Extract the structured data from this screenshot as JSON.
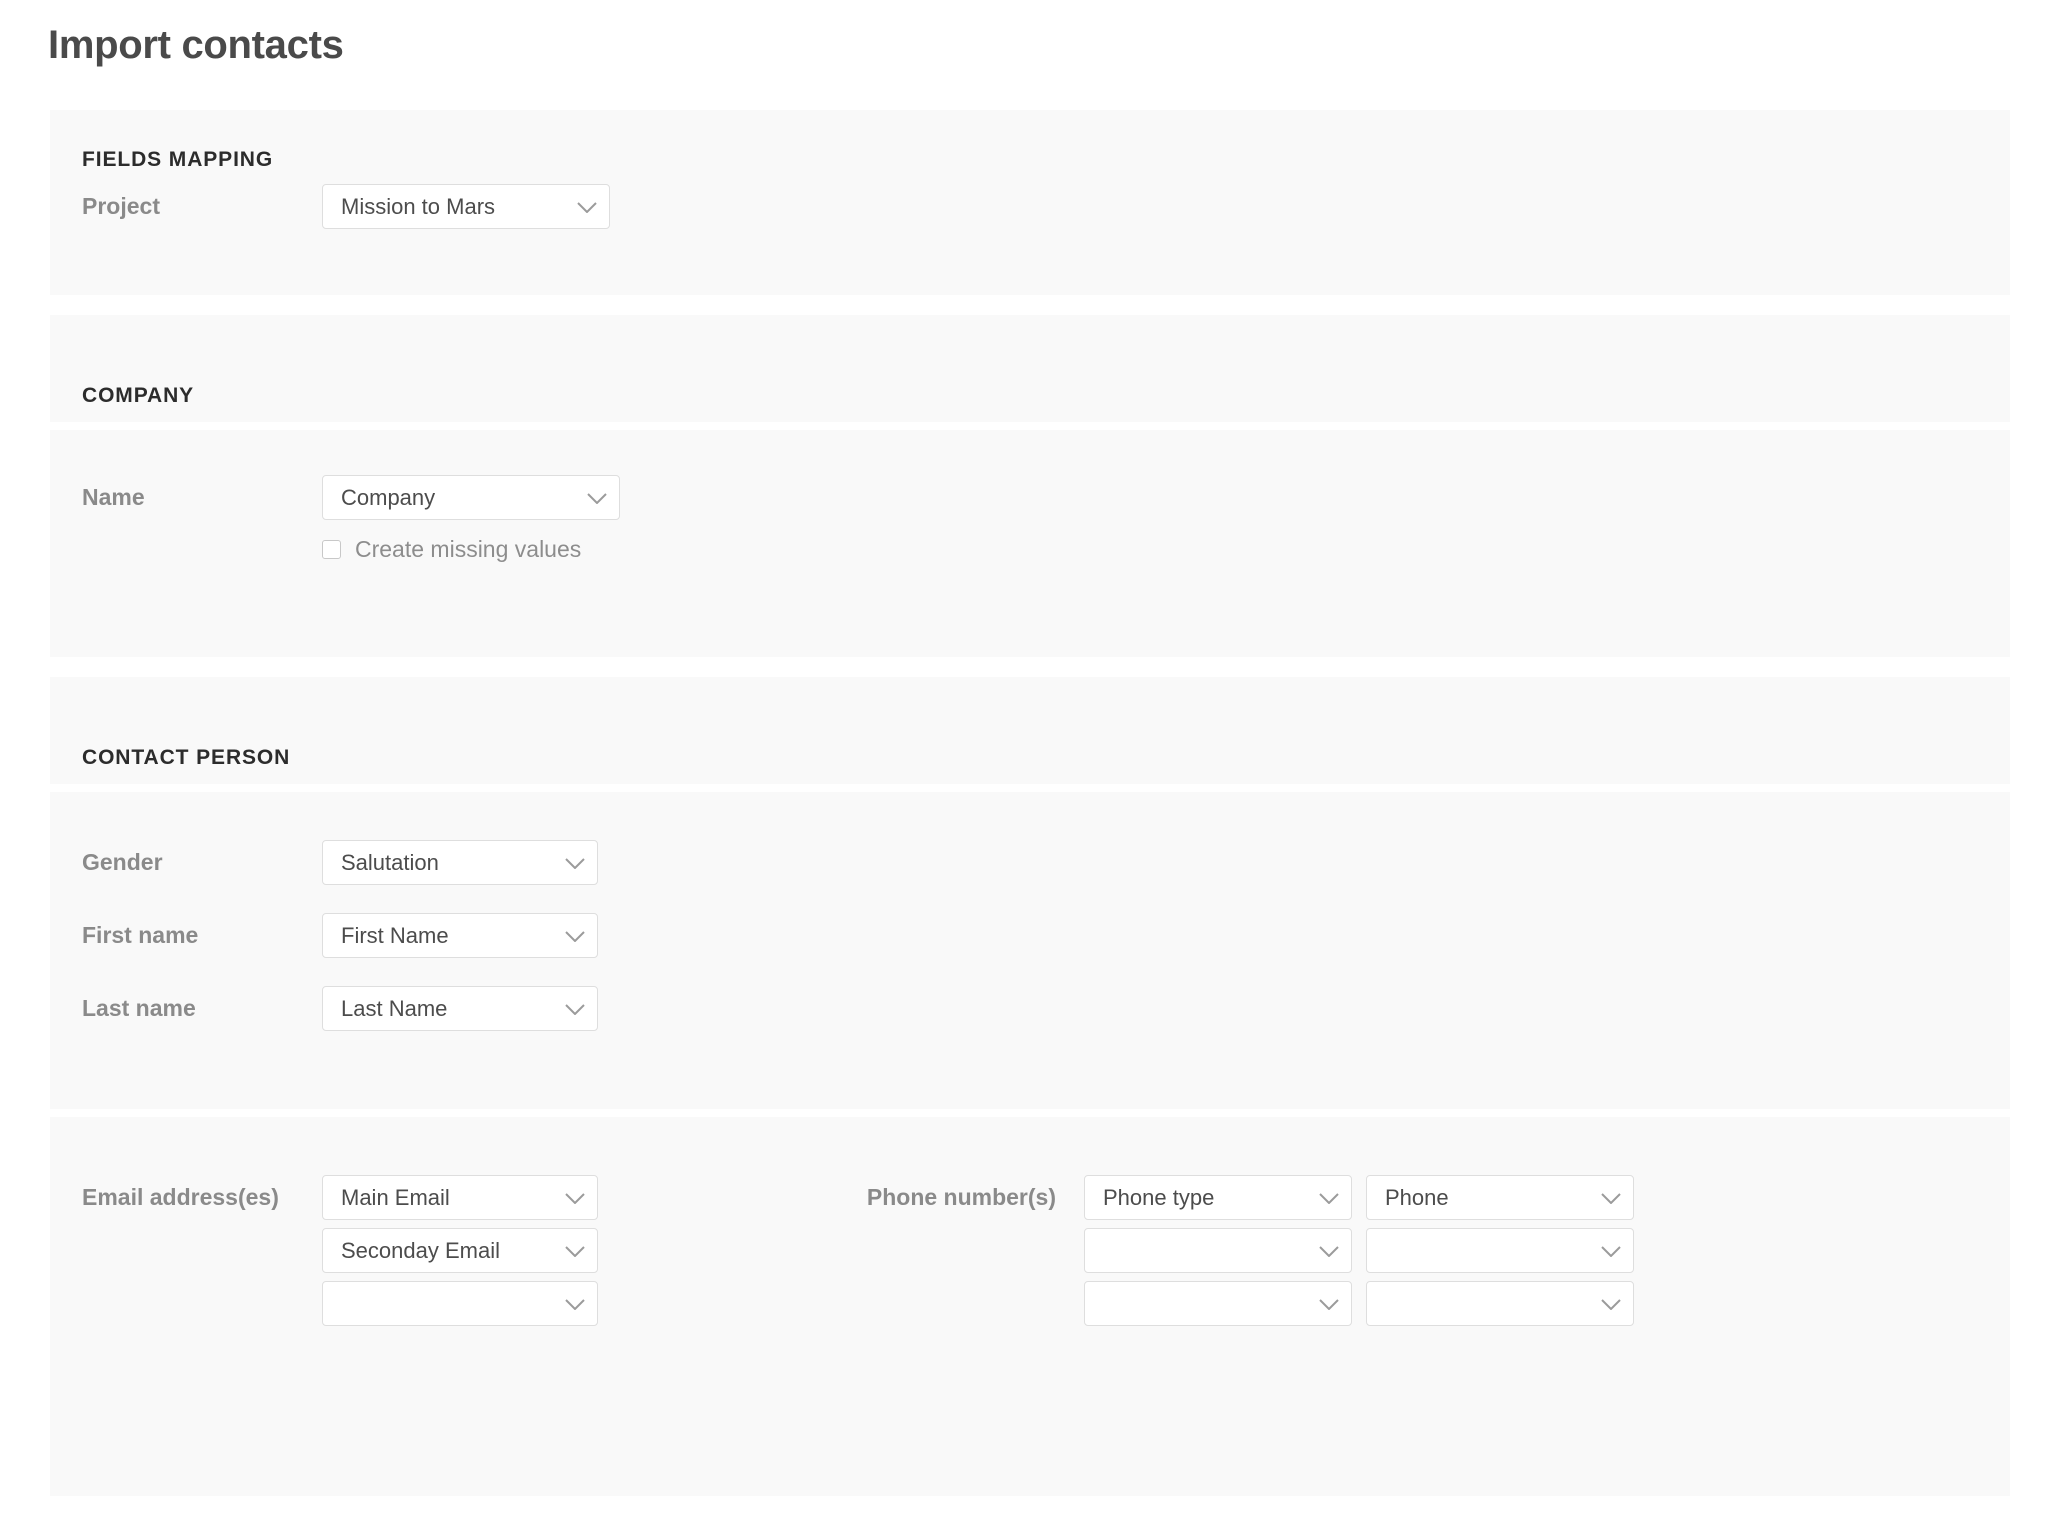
{
  "page": {
    "title": "Import contacts"
  },
  "colors": {
    "panel_bg": "#f9f9f9",
    "page_bg": "#ffffff",
    "label": "#8a8a8a",
    "heading": "#2c2c2c",
    "value": "#4c4c4c",
    "border": "#dedede"
  },
  "sections": {
    "fields_mapping": {
      "title": "FIELDS MAPPING",
      "rows": [
        {
          "label": "Project",
          "value": "Mission to Mars"
        }
      ]
    },
    "company": {
      "title": "COMPANY",
      "rows": [
        {
          "label": "Name",
          "value": "Company"
        }
      ],
      "checkbox": {
        "label": "Create missing values",
        "checked": false
      }
    },
    "contact_person": {
      "title": "CONTACT PERSON",
      "rows": [
        {
          "label": "Gender",
          "value": "Salutation"
        },
        {
          "label": "First name",
          "value": "First Name"
        },
        {
          "label": "Last name",
          "value": "Last Name"
        }
      ],
      "email": {
        "label": "Email address(es)",
        "values": [
          "Main Email",
          "Seconday Email",
          ""
        ]
      },
      "phone": {
        "label": "Phone number(s)",
        "type_values": [
          "Phone type",
          "",
          ""
        ],
        "number_values": [
          "Phone",
          "",
          ""
        ]
      }
    }
  },
  "icons": {
    "chevron_down": "chevron-down-icon",
    "checkbox": "checkbox-icon"
  }
}
